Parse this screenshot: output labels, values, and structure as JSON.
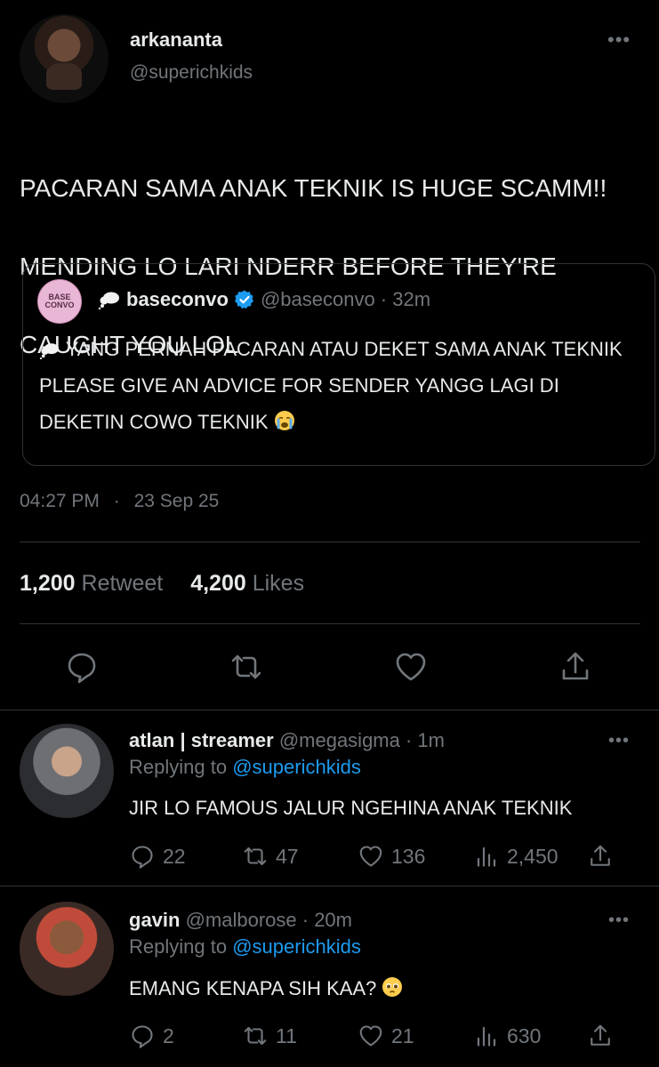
{
  "tweet": {
    "author_name": "arkananta",
    "author_handle": "@superichkids",
    "text_line1": "PACARAN SAMA ANAK TEKNIK IS HUGE SCAMM!!",
    "text_line2": "MENDING LO LARI NDERR BEFORE THEY'RE",
    "text_line3": "CAUGHT YOU LOL",
    "time": "04:27 PM",
    "separator": "·",
    "date": "23 Sep 25",
    "retweet_count": "1,200",
    "retweet_label": "Retweet",
    "like_count": "4,200",
    "like_label": "Likes"
  },
  "quote": {
    "avatar_text": "BASE CONVO",
    "name": "baseconvo",
    "handle_time": "@baseconvo · 32m",
    "line1": "YANG PERNAH PACARAN ATAU DEKET SAMA ANAK TEKNIK",
    "line2": "PLEASE GIVE AN ADVICE FOR SENDER YANGG LAGI DI",
    "line3": "DEKETIN COWO TEKNIK"
  },
  "replies": [
    {
      "name": "atlan | streamer",
      "handle_time": "@megasigma · 1m",
      "replying_prefix": "Replying to",
      "replying_handle": "@superichkids",
      "text": "JIR LO FAMOUS JALUR NGEHINA ANAK TEKNIK",
      "replies": "22",
      "retweets": "47",
      "likes": "136",
      "views": "2,450"
    },
    {
      "name": "gavin",
      "handle_time": "@malborose · 20m",
      "replying_prefix": "Replying to",
      "replying_handle": "@superichkids",
      "text": "EMANG KENAPA SIH KAA?",
      "replies": "2",
      "retweets": "11",
      "likes": "21",
      "views": "630"
    }
  ],
  "icons": {
    "more": "more-horizontal-icon",
    "reply": "reply-icon",
    "retweet": "retweet-icon",
    "like": "heart-icon",
    "share": "share-icon",
    "views": "views-icon",
    "verified": "verified-badge-icon",
    "thought_bubble": "thought-bubble-icon",
    "crying_emoji": "crying-face-emoji",
    "pleading_emoji": "pleading-face-emoji"
  },
  "colors": {
    "background": "#000000",
    "text": "#e7e9ea",
    "muted": "#71767b",
    "link": "#1d9bf0",
    "border": "#2f3336"
  }
}
